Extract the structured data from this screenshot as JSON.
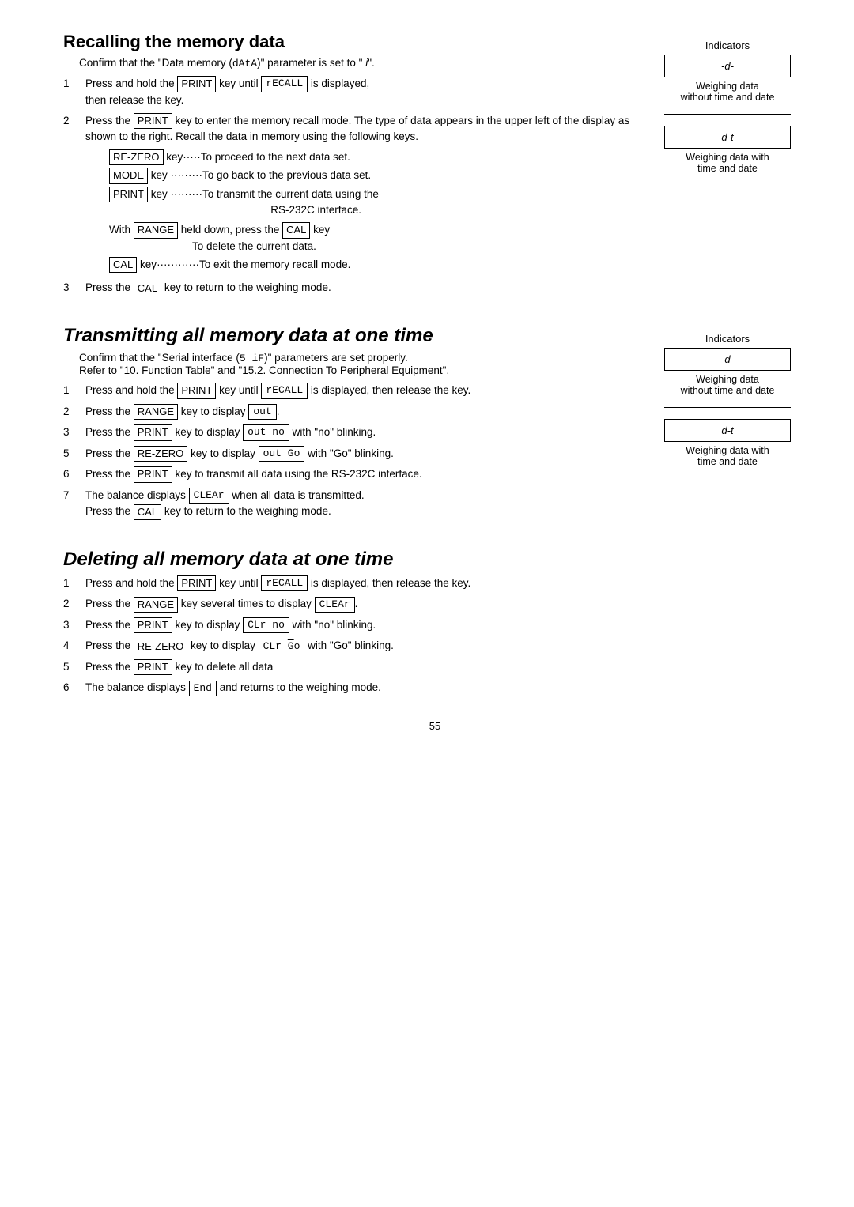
{
  "sections": [
    {
      "id": "recalling",
      "title": "Recalling the memory data",
      "title_style": "normal",
      "intro": "Confirm that the \"Data memory (dAtA)\" parameter is set to \" i\".",
      "steps": [
        {
          "num": "1",
          "text": "Press and hold the [PRINT] key until [rECALL] is displayed, then release the key."
        },
        {
          "num": "2",
          "text": "Press the [PRINT] key to enter the memory recall mode. The type of data appears in the upper left of the display as shown to the right. Recall the data in memory using the following keys.",
          "keylist": [
            {
              "key": "RE-ZERO",
              "dots": "·····",
              "desc": "To proceed to the next data set."
            },
            {
              "key": "MODE",
              "dots": "·········",
              "desc": "To go back to the previous data set."
            },
            {
              "key": "PRINT",
              "dots": "·········",
              "desc": "To transmit the current data using the RS-232C interface."
            }
          ],
          "with_range": "With [RANGE] held down, press the [CAL] key",
          "with_range2": "To delete the current data.",
          "cal_line": "[CAL] key············To exit the memory recall mode."
        },
        {
          "num": "3",
          "text": "Press the [CAL] key to return to the weighing mode."
        }
      ],
      "indicators": {
        "label": "Indicators",
        "items": [
          {
            "display": "-d-",
            "caption": "Weighing data\nwithout time and date"
          },
          {
            "display": "d-t",
            "caption": "Weighing data with\ntime and date"
          }
        ]
      }
    },
    {
      "id": "transmitting",
      "title": "Transmitting all memory data at one time",
      "title_style": "italic",
      "intro": "Confirm that the \"Serial interface (5 iF)\" parameters are set properly.\nRefer to \"10. Function Table\" and \"15.2. Connection To Peripheral Equipment\".",
      "steps": [
        {
          "num": "1",
          "text": "Press and hold the [PRINT] key until [rECALL] is displayed, then release the key."
        },
        {
          "num": "2",
          "text": "Press the [RANGE] key to display [out]."
        },
        {
          "num": "3",
          "text": "Press the [PRINT] key to display [out no] with \"no\" blinking."
        },
        {
          "num": "5",
          "text": "Press the [RE-ZERO] key to display [out Go] with \"Go\" blinking."
        },
        {
          "num": "6",
          "text": "Press the [PRINT] key to transmit all data using the RS-232C interface."
        },
        {
          "num": "7",
          "text": "The balance displays [CLEAr] when all data is transmitted.\nPress the [CAL] key to return to the weighing mode."
        }
      ],
      "indicators": {
        "label": "Indicators",
        "items": [
          {
            "display": "-d-",
            "caption": "Weighing data\nwithout time and date"
          },
          {
            "display": "d-t",
            "caption": "Weighing data with\ntime and date"
          }
        ]
      }
    },
    {
      "id": "deleting",
      "title": "Deleting all memory data at one time",
      "title_style": "italic",
      "steps": [
        {
          "num": "1",
          "text": "Press and hold the [PRINT] key until [rECALL] is displayed, then release the key."
        },
        {
          "num": "2",
          "text": "Press the [RANGE] key several times to display [CLEAr]."
        },
        {
          "num": "3",
          "text": "Press the [PRINT] key to display [CLr no] with \"no\" blinking."
        },
        {
          "num": "4",
          "text": "Press the [RE-ZERO] key to display [CLr Go] with \"Go\" blinking."
        },
        {
          "num": "5",
          "text": "Press the [PRINT] key to delete all data"
        },
        {
          "num": "6",
          "text": "The balance displays [End] and returns to the weighing mode."
        }
      ]
    }
  ],
  "page_number": "55"
}
